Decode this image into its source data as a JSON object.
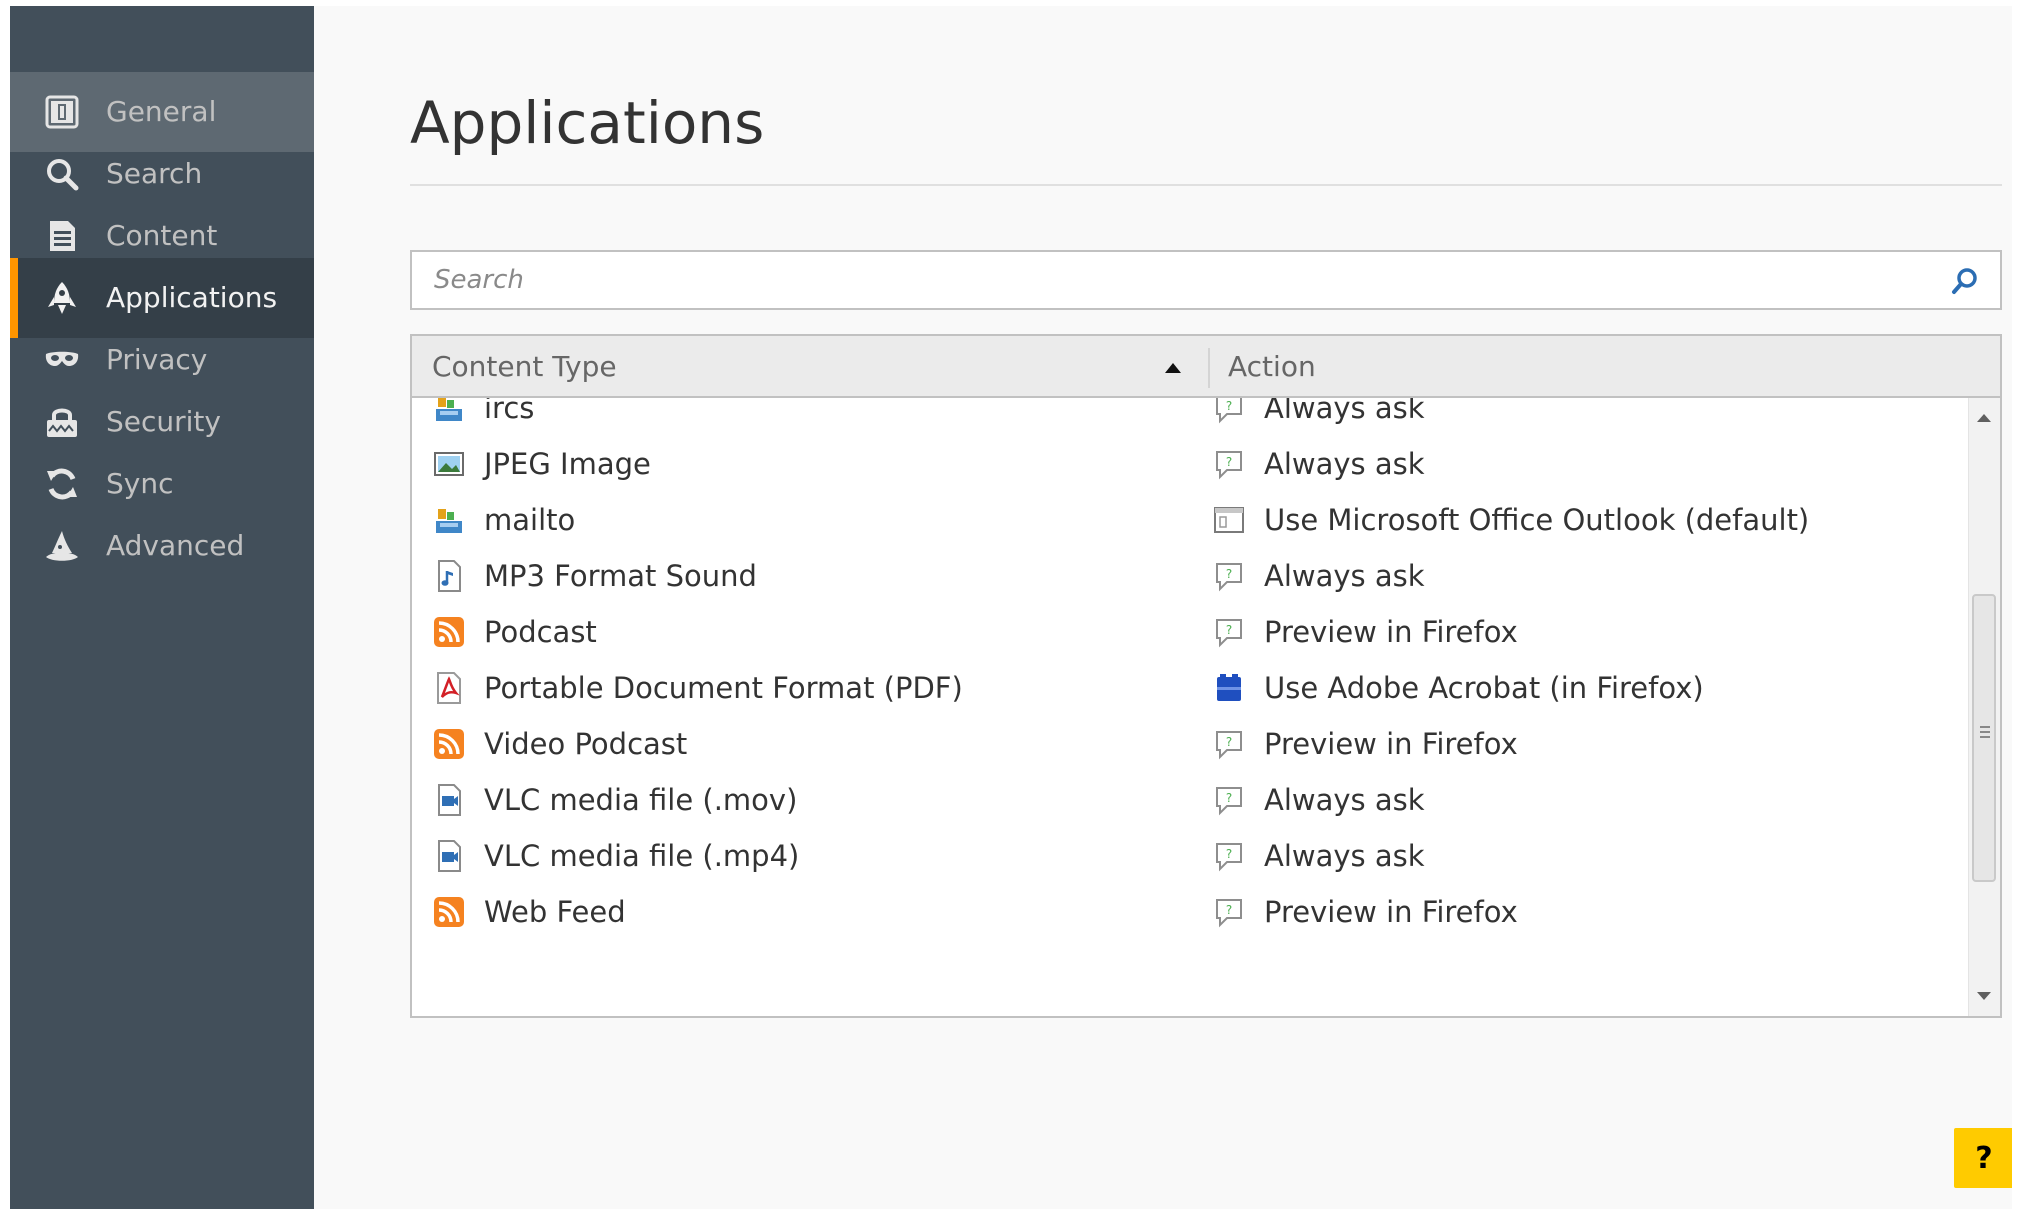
{
  "sidebar": {
    "items": [
      {
        "label": "General",
        "icon": "general-icon"
      },
      {
        "label": "Search",
        "icon": "search-icon"
      },
      {
        "label": "Content",
        "icon": "content-icon"
      },
      {
        "label": "Applications",
        "icon": "applications-rocket-icon",
        "active": true
      },
      {
        "label": "Privacy",
        "icon": "privacy-mask-icon"
      },
      {
        "label": "Security",
        "icon": "security-lock-icon"
      },
      {
        "label": "Sync",
        "icon": "sync-icon"
      },
      {
        "label": "Advanced",
        "icon": "advanced-wizard-hat-icon"
      }
    ]
  },
  "main": {
    "title": "Applications",
    "search": {
      "placeholder": "Search",
      "value": ""
    },
    "table": {
      "columns": {
        "content_type": "Content Type",
        "action": "Action"
      },
      "sort": "ascending",
      "rows": [
        {
          "content_type": "ircs",
          "type_icon": "app-icon",
          "action": "Always ask",
          "action_icon": "ask-icon"
        },
        {
          "content_type": "JPEG Image",
          "type_icon": "image-icon",
          "action": "Always ask",
          "action_icon": "ask-icon"
        },
        {
          "content_type": "mailto",
          "type_icon": "app-icon",
          "action": "Use Microsoft Office Outlook (default)",
          "action_icon": "window-icon"
        },
        {
          "content_type": "MP3 Format Sound",
          "type_icon": "audio-file-icon",
          "action": "Always ask",
          "action_icon": "ask-icon"
        },
        {
          "content_type": "Podcast",
          "type_icon": "feed-icon",
          "action": "Preview in Firefox",
          "action_icon": "ask-icon"
        },
        {
          "content_type": "Portable Document Format (PDF)",
          "type_icon": "pdf-icon",
          "action": "Use Adobe Acrobat (in Firefox)",
          "action_icon": "acrobat-plugin-icon"
        },
        {
          "content_type": "Video Podcast",
          "type_icon": "feed-icon",
          "action": "Preview in Firefox",
          "action_icon": "ask-icon"
        },
        {
          "content_type": "VLC media file (.mov)",
          "type_icon": "media-file-icon",
          "action": "Always ask",
          "action_icon": "ask-icon"
        },
        {
          "content_type": "VLC media file (.mp4)",
          "type_icon": "media-file-icon",
          "action": "Always ask",
          "action_icon": "ask-icon"
        },
        {
          "content_type": "Web Feed",
          "type_icon": "feed-icon",
          "action": "Preview in Firefox",
          "action_icon": "ask-icon"
        }
      ]
    }
  },
  "help": {
    "label": "?"
  },
  "colors": {
    "sidebar_bg": "#424f5a",
    "sidebar_active_bg": "#343f48",
    "sidebar_hover_bg": "#5e6972",
    "accent": "#ff9500",
    "help_button": "#ffcb00",
    "feed_orange": "#f58220",
    "pdf_red": "#d32027"
  }
}
